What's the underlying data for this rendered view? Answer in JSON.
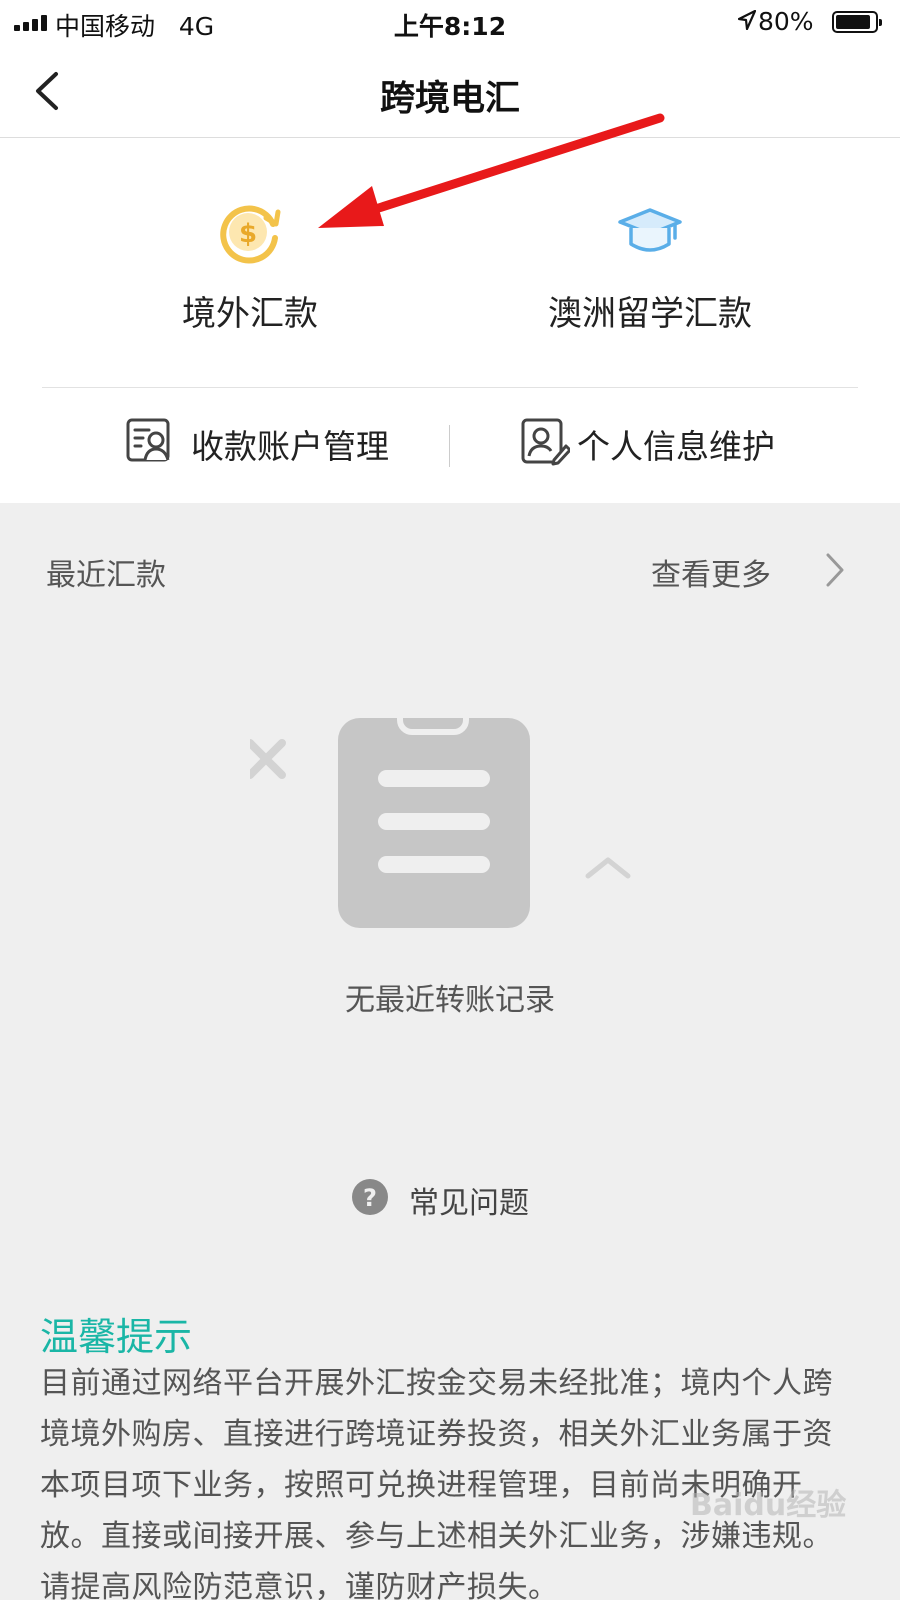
{
  "status_bar": {
    "carrier": "中国移动",
    "network": "4G",
    "time": "上午8:12",
    "battery": "80%"
  },
  "nav": {
    "title": "跨境电汇"
  },
  "services": [
    {
      "label": "境外汇款",
      "icon": "dollar-refresh-icon"
    },
    {
      "label": "澳洲留学汇款",
      "icon": "graduation-cap-icon"
    }
  ],
  "links": [
    {
      "label": "收款账户管理",
      "icon": "account-card-icon"
    },
    {
      "label": "个人信息维护",
      "icon": "user-edit-icon"
    }
  ],
  "recent": {
    "title": "最近汇款",
    "more": "查看更多",
    "empty_text": "无最近转账记录"
  },
  "faq": {
    "label": "常见问题"
  },
  "tips": {
    "title": "温馨提示",
    "body": "目前通过网络平台开展外汇按金交易未经批准；境内个人跨境境外购房、直接进行跨境证券投资，相关外汇业务属于资本项目项下业务，按照可兑换进程管理，目前尚未明确开放。直接或间接开展、参与上述相关外汇业务，涉嫌违规。请提高风险防范意识，谨防财产损失。"
  },
  "watermark": "Baidu经验",
  "colors": {
    "accent_teal": "#1ab6a6",
    "annotation_red": "#e8191a",
    "icon_gold": "#f3c34a",
    "icon_blue": "#5aaee8",
    "background": "#efefef"
  }
}
